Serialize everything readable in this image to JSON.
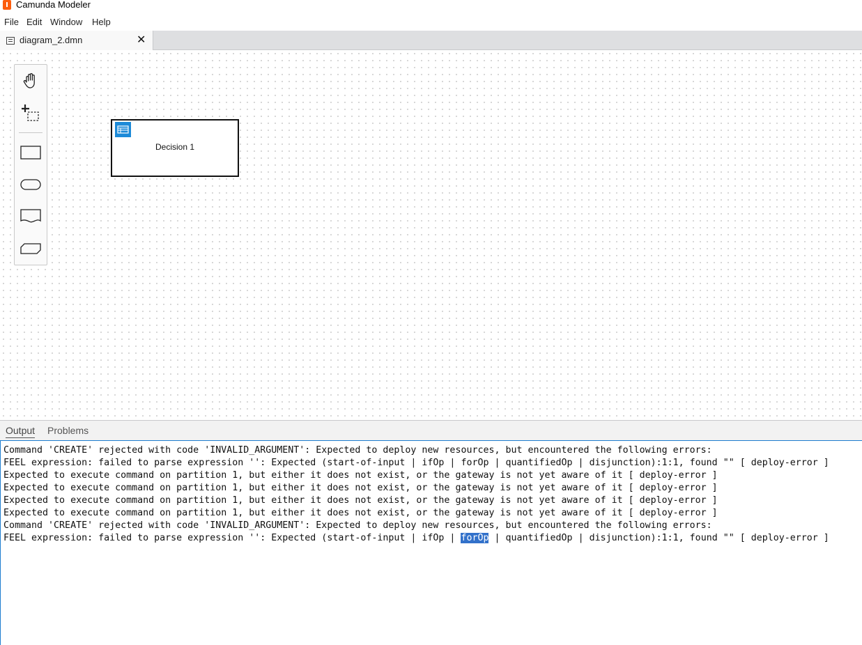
{
  "app": {
    "title": "Camunda Modeler"
  },
  "menu": {
    "items": [
      "File",
      "Edit",
      "Window",
      "Help"
    ]
  },
  "tabs": [
    {
      "label": "diagram_2.dmn",
      "close": "✕"
    }
  ],
  "palette": {
    "tools": [
      "hand-tool-icon",
      "lasso-tool-icon",
      "decision-shape-icon",
      "input-data-shape-icon",
      "knowledge-source-shape-icon",
      "business-knowledge-model-shape-icon"
    ]
  },
  "diagram": {
    "decision_label": "Decision 1"
  },
  "panel": {
    "tabs": [
      "Output",
      "Problems"
    ],
    "active_tab": "Output",
    "lines": [
      "Command 'CREATE' rejected with code 'INVALID_ARGUMENT': Expected to deploy new resources, but encountered the following errors:",
      "FEEL expression: failed to parse expression '': Expected (start-of-input | ifOp | forOp | quantifiedOp | disjunction):1:1, found \"\" [ deploy-error ]",
      "Expected to execute command on partition 1, but either it does not exist, or the gateway is not yet aware of it [ deploy-error ]",
      "Expected to execute command on partition 1, but either it does not exist, or the gateway is not yet aware of it [ deploy-error ]",
      "Expected to execute command on partition 1, but either it does not exist, or the gateway is not yet aware of it [ deploy-error ]",
      "Expected to execute command on partition 1, but either it does not exist, or the gateway is not yet aware of it [ deploy-error ]",
      "Command 'CREATE' rejected with code 'INVALID_ARGUMENT': Expected to deploy new resources, but encountered the following errors:"
    ],
    "last_line": {
      "before": "FEEL expression: failed to parse expression '': Expected (start-of-input | ifOp | ",
      "selected": "forOp",
      "after": " | quantifiedOp | disjunction):1:1, found \"\" [ deploy-error ]"
    }
  },
  "colors": {
    "accent": "#1c8ad8",
    "selection": "#3271ca",
    "brand": "#fc5d0d"
  }
}
